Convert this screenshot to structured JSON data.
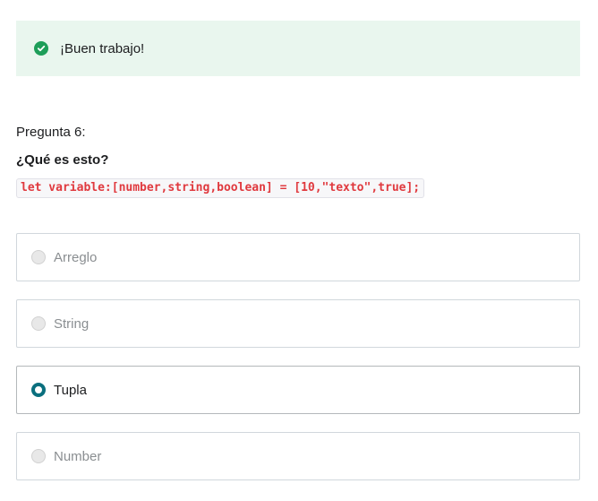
{
  "feedback": {
    "message": "¡Buen trabajo!",
    "icon": "check-circle-icon",
    "color": "#1e9e59",
    "background": "#e9f6ee"
  },
  "question": {
    "number_label": "Pregunta 6:",
    "title": "¿Qué es esto?",
    "code": "let variable:[number,string,boolean] = [10,\"texto\",true];"
  },
  "options": [
    {
      "label": "Arreglo",
      "selected": false
    },
    {
      "label": "String",
      "selected": false
    },
    {
      "label": "Tupla",
      "selected": true
    },
    {
      "label": "Number",
      "selected": false
    }
  ],
  "colors": {
    "accent": "#0a6f7e",
    "code_text": "#e0393e"
  }
}
